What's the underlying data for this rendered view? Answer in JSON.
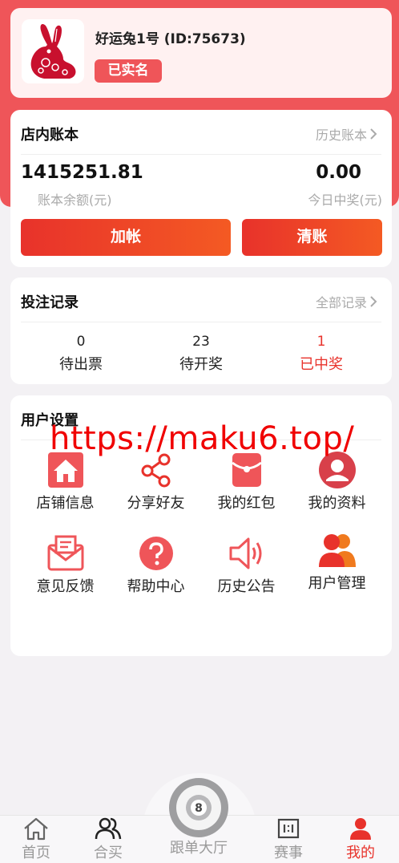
{
  "profile": {
    "name": "好运兔1号 (ID:75673)",
    "badge": "已实名",
    "avatar_icon": "rabbit-papercut-icon"
  },
  "ledger": {
    "title": "店内账本",
    "link": "历史账本",
    "balance": "1415251.81",
    "balance_label": "账本余额(元)",
    "today": "0.00",
    "today_label": "今日中奖(元)",
    "add_button": "加帐",
    "clear_button": "清账"
  },
  "bets": {
    "title": "投注记录",
    "link": "全部记录",
    "stats": [
      {
        "value": "0",
        "label": "待出票"
      },
      {
        "value": "23",
        "label": "待开奖"
      },
      {
        "value": "1",
        "label": "已中奖"
      }
    ]
  },
  "settings": {
    "title": "用户设置",
    "items": [
      {
        "label": "店铺信息",
        "icon": "store-home-icon"
      },
      {
        "label": "分享好友",
        "icon": "share-icon"
      },
      {
        "label": "我的红包",
        "icon": "red-envelope-icon"
      },
      {
        "label": "我的资料",
        "icon": "profile-icon"
      },
      {
        "label": "意见反馈",
        "icon": "feedback-envelope-icon"
      },
      {
        "label": "帮助中心",
        "icon": "help-icon"
      },
      {
        "label": "历史公告",
        "icon": "speaker-icon"
      },
      {
        "label": "用户管理",
        "icon": "users-icon"
      }
    ]
  },
  "watermark": "https://maku6.top/",
  "tabbar": {
    "items": [
      {
        "label": "首页",
        "icon": "home-icon"
      },
      {
        "label": "合买",
        "icon": "group-icon"
      },
      {
        "label": "跟单大厅",
        "icon": "eight-ball-icon"
      },
      {
        "label": "赛事",
        "icon": "scoreboard-icon"
      },
      {
        "label": "我的",
        "icon": "user-icon"
      }
    ]
  },
  "colors": {
    "accent": "#ef5559",
    "button": "#e8322b",
    "active_tab": "#e8322b"
  }
}
